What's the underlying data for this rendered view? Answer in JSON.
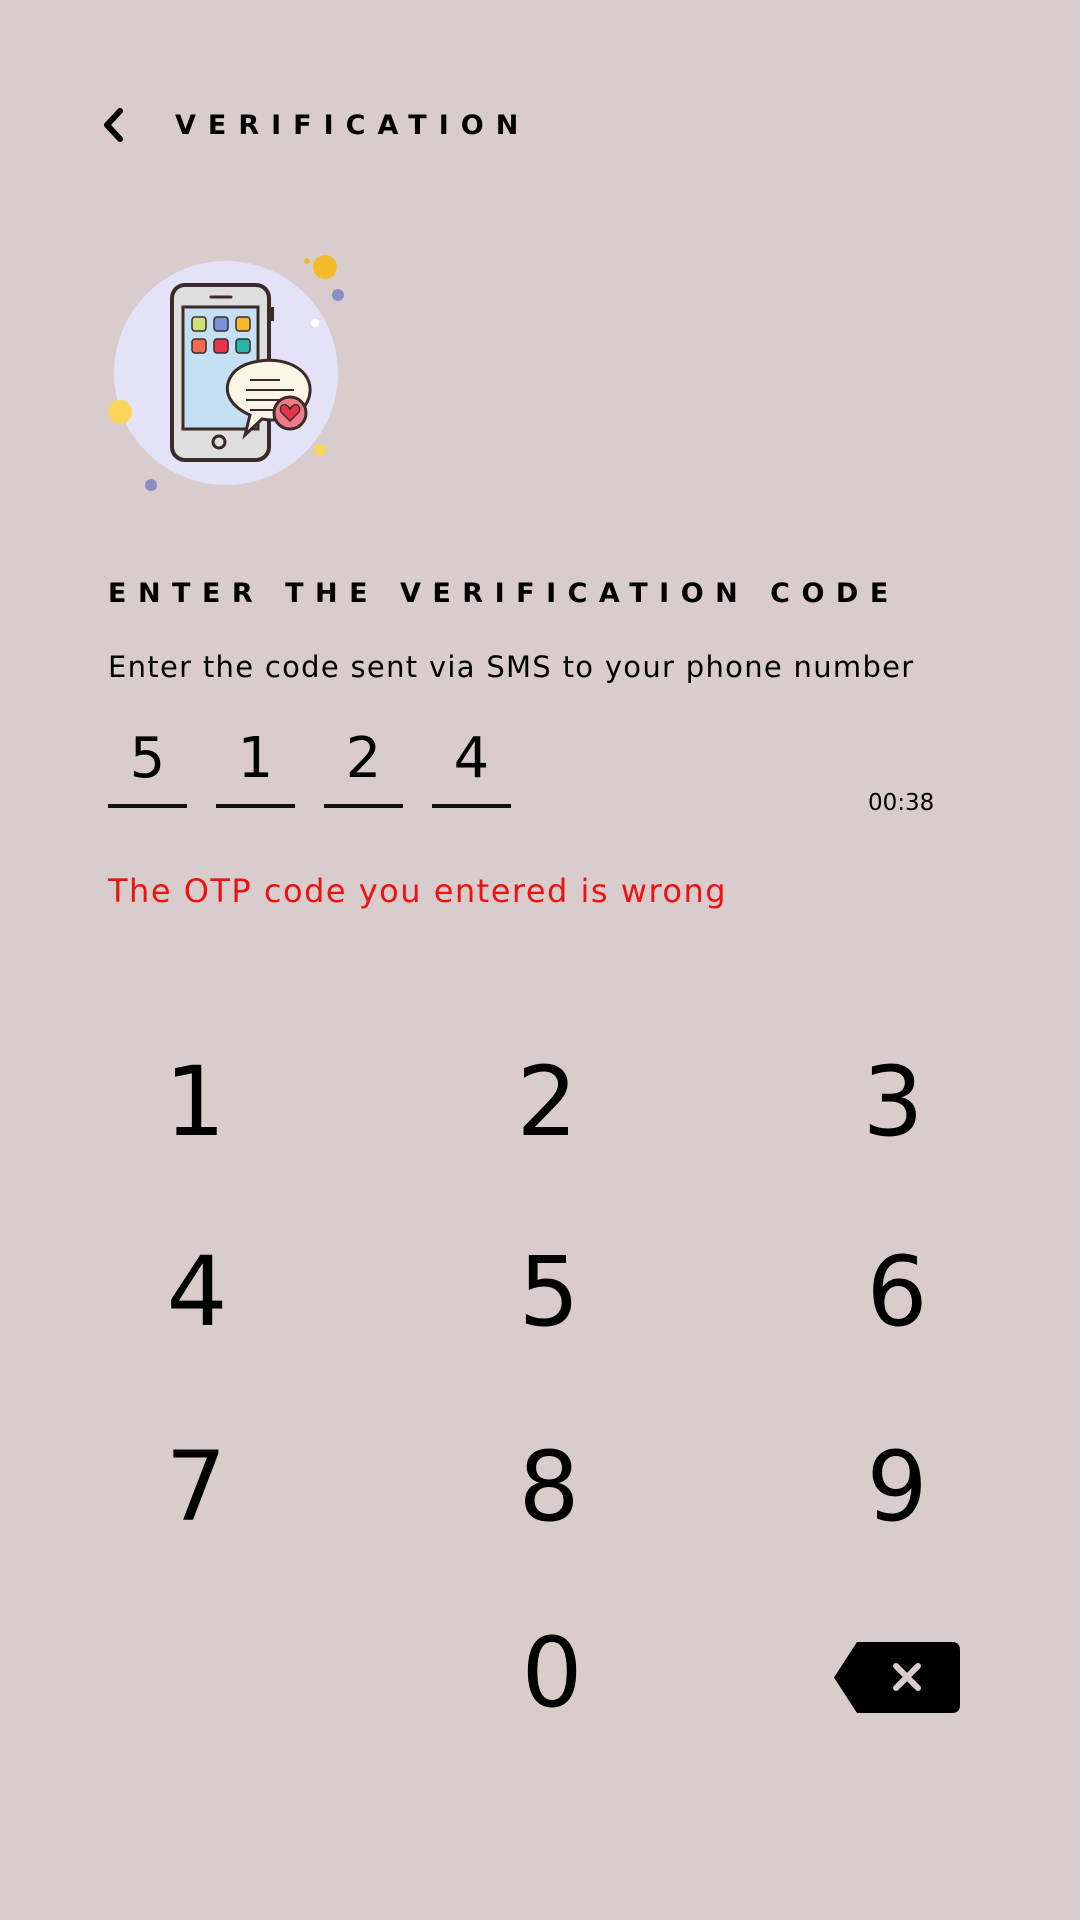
{
  "header": {
    "title": "VERIFICATION",
    "back_icon": "chevron-left-icon"
  },
  "illustration": {
    "icon": "phone-message-illustration"
  },
  "content": {
    "heading": "ENTER THE VERIFICATION CODE",
    "subtext": "Enter the code sent via SMS to your phone number",
    "otp_digits": [
      "5",
      "1",
      "2",
      "4"
    ],
    "timer": "00:38",
    "error_message": "The OTP code you entered is wrong",
    "error_color": "#ee1111"
  },
  "keypad": {
    "keys": [
      "1",
      "2",
      "3",
      "4",
      "5",
      "6",
      "7",
      "8",
      "9",
      "0"
    ],
    "backspace_icon": "backspace-icon"
  }
}
